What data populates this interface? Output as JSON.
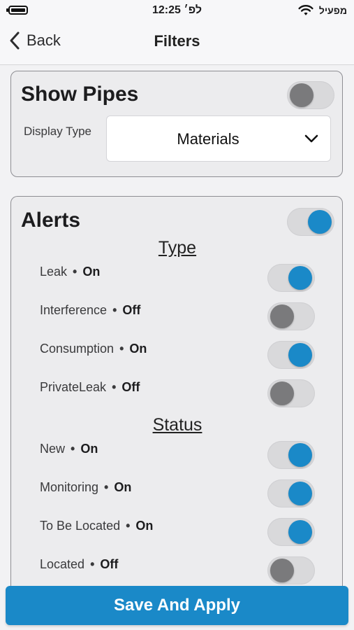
{
  "status_bar": {
    "time": "12:25 לפ׳",
    "carrier": "מפעיל"
  },
  "nav": {
    "back_label": "Back",
    "title": "Filters"
  },
  "pipes": {
    "title": "Show Pipes",
    "toggle_on": false,
    "display_type_label": "Display Type",
    "display_type_value": "Materials"
  },
  "alerts": {
    "title": "Alerts",
    "toggle_on": true,
    "type_heading": "Type",
    "types": [
      {
        "name": "Leak",
        "state": "On",
        "on": true
      },
      {
        "name": "Interference",
        "state": "Off",
        "on": false
      },
      {
        "name": "Consumption",
        "state": "On",
        "on": true
      },
      {
        "name": "PrivateLeak",
        "state": "Off",
        "on": false
      }
    ],
    "status_heading": "Status",
    "statuses": [
      {
        "name": "New",
        "state": "On",
        "on": true
      },
      {
        "name": "Monitoring",
        "state": "On",
        "on": true
      },
      {
        "name": "To Be Located",
        "state": "On",
        "on": true
      },
      {
        "name": "Located",
        "state": "Off",
        "on": false
      }
    ]
  },
  "footer": {
    "save_label": "Save And Apply"
  },
  "colors": {
    "accent": "#1a89c8",
    "toggle_off_knob": "#7a7a7c"
  }
}
